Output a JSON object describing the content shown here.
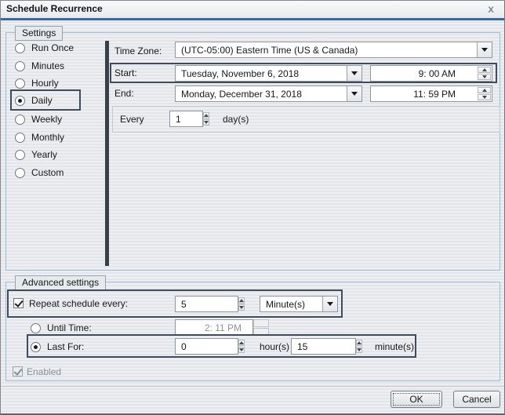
{
  "window": {
    "title": "Schedule Recurrence",
    "close": "x"
  },
  "settings": {
    "group_label": "Settings",
    "recurrence_options": [
      {
        "label": "Run Once",
        "selected": false
      },
      {
        "label": "Minutes",
        "selected": false
      },
      {
        "label": "Hourly",
        "selected": false
      },
      {
        "label": "Daily",
        "selected": true
      },
      {
        "label": "Weekly",
        "selected": false
      },
      {
        "label": "Monthly",
        "selected": false
      },
      {
        "label": "Yearly",
        "selected": false
      },
      {
        "label": "Custom",
        "selected": false
      }
    ],
    "time_zone": {
      "label": "Time Zone:",
      "value": "(UTC-05:00) Eastern Time (US & Canada)"
    },
    "start": {
      "label": "Start:",
      "date": "Tuesday, November 6, 2018",
      "time": "9: 00 AM"
    },
    "end": {
      "label": "End:",
      "date": "Monday, December 31, 2018",
      "time": "11: 59 PM"
    },
    "every": {
      "label": "Every",
      "value": "1",
      "unit": "day(s)"
    }
  },
  "advanced": {
    "group_label": "Advanced settings",
    "repeat": {
      "label": "Repeat schedule every:",
      "checked": true,
      "value": "5",
      "unit": "Minute(s)"
    },
    "until_time": {
      "label": "Until Time:",
      "value": "2: 11 PM",
      "selected": false,
      "disabled": true
    },
    "last_for": {
      "label": "Last For:",
      "selected": true,
      "hours": "0",
      "hours_unit": "hour(s)",
      "minutes": "15",
      "minutes_unit": "minute(s)"
    },
    "enabled": {
      "label": "Enabled",
      "checked": true,
      "disabled": true
    }
  },
  "footer": {
    "ok": "OK",
    "cancel": "Cancel"
  },
  "colors": {
    "focus_border": "#3e4c5c",
    "group_border": "#a3bad6",
    "title_underline": "#3c64ab",
    "separator_bar": "#3a4047"
  }
}
